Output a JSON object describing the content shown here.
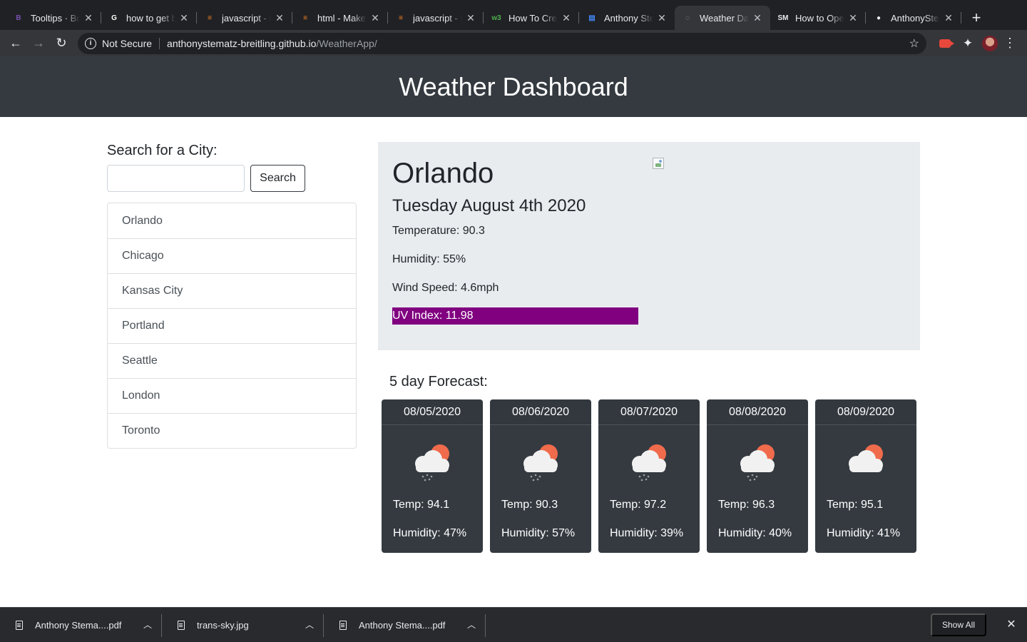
{
  "browser": {
    "tabs": [
      {
        "title": "Tooltips · Bootstrap",
        "icon": "bootstrap-icon",
        "icon_glyph": "B",
        "icon_color": "#7952b3"
      },
      {
        "title": "how to get bootstrap",
        "icon": "google-icon",
        "icon_glyph": "G",
        "icon_color": "#ffffff"
      },
      {
        "title": "javascript - How",
        "icon": "stackoverflow-icon",
        "icon_glyph": "≡",
        "icon_color": "#f48024"
      },
      {
        "title": "html - Make",
        "icon": "stackoverflow-icon",
        "icon_glyph": "≡",
        "icon_color": "#f48024"
      },
      {
        "title": "javascript - How",
        "icon": "stackoverflow-icon",
        "icon_glyph": "≡",
        "icon_color": "#f48024"
      },
      {
        "title": "How To Create",
        "icon": "w3schools-icon",
        "icon_glyph": "w3",
        "icon_color": "#4caf50"
      },
      {
        "title": "Anthony Stematz",
        "icon": "google-docs-icon",
        "icon_glyph": "▤",
        "icon_color": "#4285f4"
      },
      {
        "title": "Weather Dashboard",
        "icon": "globe-icon",
        "icon_glyph": "◌",
        "icon_color": "#9aa0a6",
        "active": true
      },
      {
        "title": "How to Open",
        "icon": "sdk-icon",
        "icon_glyph": "SM",
        "icon_color": "#e8eaed"
      },
      {
        "title": "AnthonyStematz",
        "icon": "github-icon",
        "icon_glyph": "●",
        "icon_color": "#e8eaed"
      }
    ],
    "new_tab_label": "+",
    "security_label": "Not Secure",
    "url_host": "anthonystematz-breitling.github.io",
    "url_path": "/WeatherApp/"
  },
  "header": {
    "title": "Weather Dashboard"
  },
  "search": {
    "label": "Search for a City:",
    "placeholder": "",
    "value": "",
    "button_label": "Search"
  },
  "cities": [
    "Orlando",
    "Chicago",
    "Kansas City",
    "Portland",
    "Seattle",
    "London",
    "Toronto"
  ],
  "current": {
    "city": "Orlando",
    "date": "Tuesday August 4th 2020",
    "temperature": "Temperature: 90.3",
    "humidity": "Humidity: 55%",
    "wind": "Wind Speed: 4.6mph",
    "uv": "UV Index: 11.98",
    "uv_color": "#800080",
    "weather_icon": "broken-image-icon"
  },
  "forecast": {
    "heading": "5 day Forecast:",
    "days": [
      {
        "date": "08/05/2020",
        "temp": "Temp: 94.1",
        "humidity": "Humidity: 47%",
        "icon": "rain-sun-cloud-icon"
      },
      {
        "date": "08/06/2020",
        "temp": "Temp: 90.3",
        "humidity": "Humidity: 57%",
        "icon": "rain-sun-cloud-icon"
      },
      {
        "date": "08/07/2020",
        "temp": "Temp: 97.2",
        "humidity": "Humidity: 39%",
        "icon": "rain-sun-cloud-icon"
      },
      {
        "date": "08/08/2020",
        "temp": "Temp: 96.3",
        "humidity": "Humidity: 40%",
        "icon": "rain-sun-cloud-icon"
      },
      {
        "date": "08/09/2020",
        "temp": "Temp: 95.1",
        "humidity": "Humidity: 41%",
        "icon": "sun-cloud-icon"
      }
    ]
  },
  "downloads": {
    "items": [
      {
        "name": "Anthony Stema....pdf"
      },
      {
        "name": "trans-sky.jpg"
      },
      {
        "name": "Anthony Stema....pdf"
      }
    ],
    "show_all_label": "Show All"
  },
  "colors": {
    "header_bg": "#343a40",
    "card_bg": "#e9ecef",
    "forecast_bg": "#343a40",
    "uv_purple": "#800080"
  }
}
